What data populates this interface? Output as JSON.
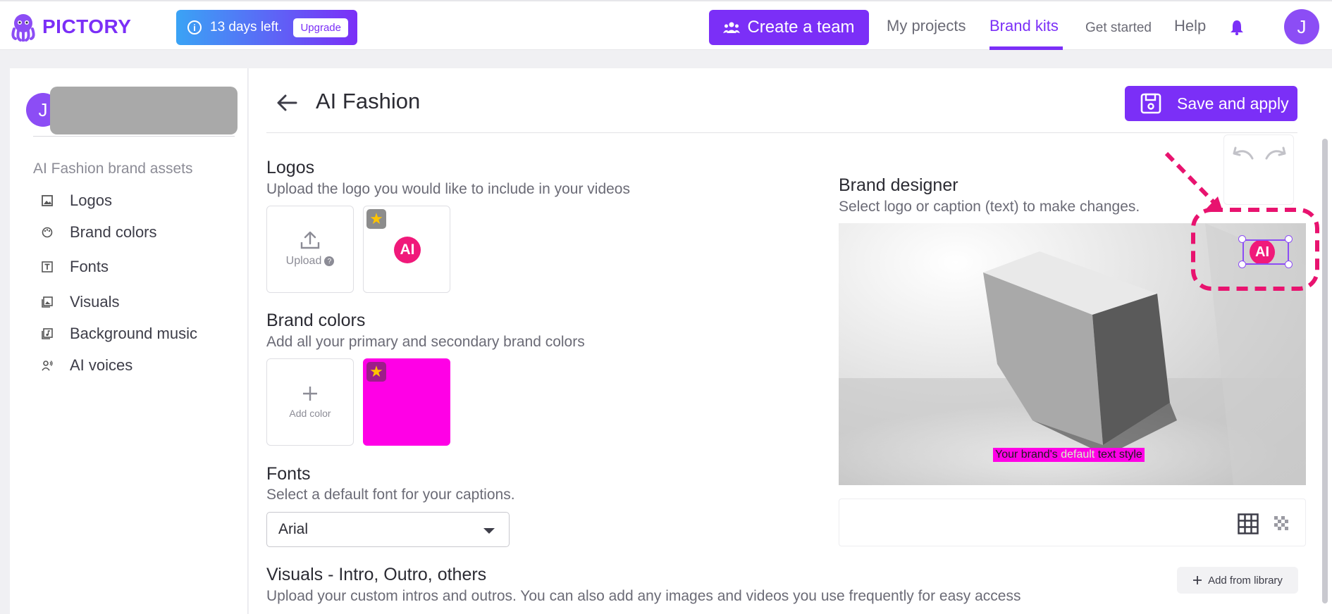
{
  "brand": {
    "name": "PICTORY"
  },
  "trial": {
    "text": "13 days left.",
    "upgrade_label": "Upgrade"
  },
  "nav": {
    "create_team": "Create a team",
    "my_projects": "My projects",
    "brand_kits": "Brand kits",
    "get_started": "Get started",
    "help": "Help",
    "avatar_initial": "J"
  },
  "sidebar": {
    "avatar_initial": "J",
    "section_title": "AI Fashion brand assets",
    "items": [
      {
        "label": "Logos",
        "icon": "image-icon"
      },
      {
        "label": "Brand colors",
        "icon": "palette-icon"
      },
      {
        "label": "Fonts",
        "icon": "text-icon"
      },
      {
        "label": "Visuals",
        "icon": "gallery-icon"
      },
      {
        "label": "Background music",
        "icon": "music-icon"
      },
      {
        "label": "AI voices",
        "icon": "voice-icon"
      }
    ]
  },
  "page": {
    "title": "AI Fashion",
    "save_label": "Save and apply"
  },
  "logos": {
    "title": "Logos",
    "subtitle": "Upload the logo you would like to include in your videos",
    "upload_label": "Upload",
    "logo_text": "AI"
  },
  "brand_colors": {
    "title": "Brand colors",
    "subtitle": "Add all your primary and secondary brand colors",
    "add_label": "Add color",
    "swatch_color": "#ff00e6"
  },
  "fonts": {
    "title": "Fonts",
    "subtitle": "Select a default font for your captions.",
    "selected": "Arial"
  },
  "visuals": {
    "title": "Visuals - Intro, Outro, others",
    "subtitle": "Upload your custom intros and outros. You can also add any images and videos you use frequently for easy access",
    "add_library_label": "Add from library"
  },
  "designer": {
    "title": "Brand designer",
    "subtitle": "Select logo or caption (text) to make changes.",
    "caption_before": "Your brand's ",
    "caption_highlight": "default",
    "caption_after": " text style",
    "logo_text": "AI"
  },
  "colors": {
    "accent": "#7b2ff7",
    "logo_pink": "#f0197a",
    "annotation": "#e8136f"
  }
}
